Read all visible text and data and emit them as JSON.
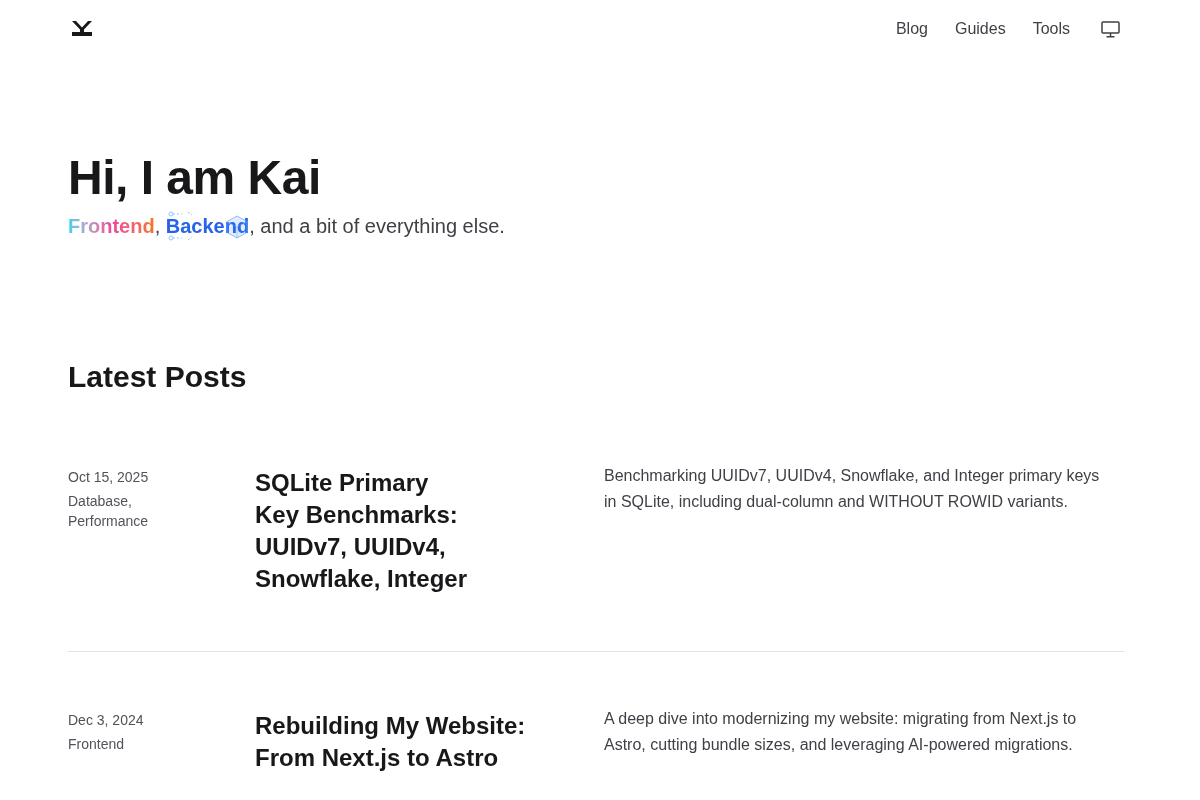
{
  "header": {
    "nav": [
      {
        "label": "Blog"
      },
      {
        "label": "Guides"
      },
      {
        "label": "Tools"
      }
    ]
  },
  "hero": {
    "title": "Hi, I am Kai",
    "tagline": [
      {
        "kind": "gradient",
        "text": "Frontend"
      },
      {
        "kind": "plain",
        "text": ", "
      },
      {
        "kind": "circuit",
        "text": "Backend"
      },
      {
        "kind": "plain",
        "text": ", and a bit of everything else."
      }
    ]
  },
  "latest_posts": {
    "heading": "Latest Posts",
    "posts": [
      {
        "date": "Oct 15, 2025",
        "tags": "Database, Performance",
        "title": "SQLite Primary Key Benchmarks: UUIDv7, UUIDv4, Snowflake, Integer",
        "summary": "Benchmarking UUIDv7, UUIDv4, Snowflake, and Integer primary keys in SQLite, including dual-column and WITHOUT ROWID variants."
      },
      {
        "date": "Dec 3, 2024",
        "tags": "Frontend",
        "title": "Rebuilding My Website: From Next.js to Astro",
        "summary": "A deep dive into modernizing my website: migrating from Next.js to Astro, cutting bundle sizes, and leveraging AI-powered migrations."
      }
    ]
  }
}
